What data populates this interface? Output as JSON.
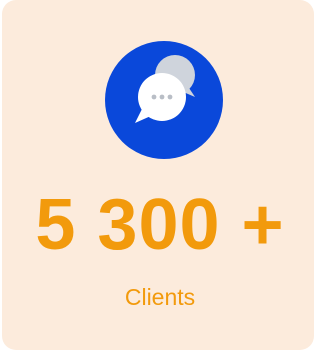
{
  "stat": {
    "icon": "chat-bubbles-icon",
    "value": "5 300 +",
    "label": "Clients"
  },
  "colors": {
    "card_background": "#fcebdc",
    "icon_circle": "#0a48da",
    "accent": "#f29a0c"
  }
}
